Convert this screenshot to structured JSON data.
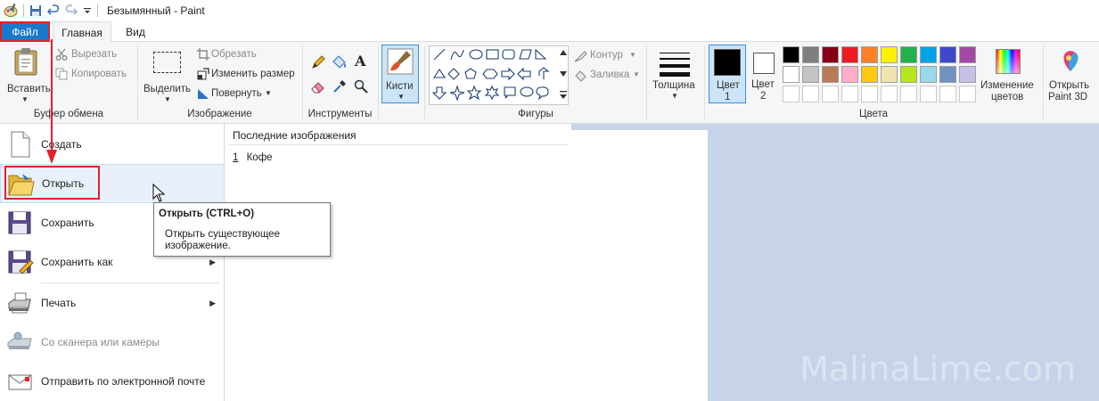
{
  "titlebar": {
    "title": "Безымянный - Paint"
  },
  "tabs": {
    "file": "Файл",
    "home": "Главная",
    "view": "Вид"
  },
  "ribbon": {
    "clipboard": {
      "label": "Буфер обмена",
      "paste": "Вставить",
      "cut": "Вырезать",
      "copy": "Копировать"
    },
    "image": {
      "label": "Изображение",
      "select": "Выделить",
      "crop": "Обрезать",
      "resize": "Изменить размер",
      "rotate": "Повернуть"
    },
    "tools": {
      "label": "Инструменты"
    },
    "brushes": {
      "label": "Кисти"
    },
    "shapes": {
      "label": "Фигуры",
      "outline": "Контур",
      "fill": "Заливка"
    },
    "size": {
      "label": "Толщина"
    },
    "colors": {
      "label": "Цвета",
      "color1": "Цвет 1",
      "color1_line1": "Цвет",
      "color1_line2": "1",
      "color2_line1": "Цвет",
      "color2_line2": "2",
      "edit_line1": "Изменение",
      "edit_line2": "цветов",
      "color1_value": "#000000",
      "color2_value": "#ffffff",
      "palette_row1": [
        "#000000",
        "#7f7f7f",
        "#880015",
        "#ed1c24",
        "#ff7f27",
        "#fff200",
        "#22b14c",
        "#00a2e8",
        "#3f48cc",
        "#a349a4"
      ],
      "palette_row2": [
        "#ffffff",
        "#c3c3c3",
        "#b97a57",
        "#ffaec9",
        "#ffc90e",
        "#efe4b0",
        "#b5e61d",
        "#99d9ea",
        "#7092be",
        "#c8bfe7"
      ]
    },
    "paint3d_line1": "Открыть",
    "paint3d_line2": "Paint 3D"
  },
  "file_menu": {
    "items": [
      {
        "label": "Создать",
        "icon": "new-document-icon"
      },
      {
        "label": "Открыть",
        "icon": "open-folder-icon"
      },
      {
        "label": "Сохранить",
        "icon": "save-disk-icon"
      },
      {
        "label": "Сохранить как",
        "icon": "save-as-icon"
      },
      {
        "label": "Печать",
        "icon": "printer-icon"
      },
      {
        "label": "Со сканера или камеры",
        "icon": "scanner-icon"
      },
      {
        "label": "Отправить по электронной почте",
        "icon": "email-icon"
      }
    ],
    "recent_title": "Последние изображения",
    "recent": [
      {
        "num": "1",
        "name": "Кофе"
      }
    ]
  },
  "tooltip": {
    "title": "Открыть (CTRL+O)",
    "line1": "Открыть существующее",
    "line2": "изображение."
  },
  "watermark": "MalinaLime.com",
  "colors": {
    "file_tab": "#1979ca",
    "highlight_box": "#e5202a",
    "canvas_bg": "#c7d3e8"
  }
}
